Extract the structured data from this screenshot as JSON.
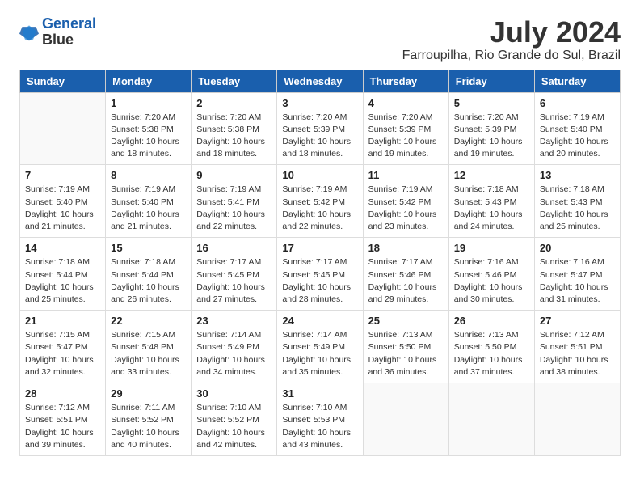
{
  "logo": {
    "line1": "General",
    "line2": "Blue"
  },
  "title": {
    "month": "July 2024",
    "location": "Farroupilha, Rio Grande do Sul, Brazil"
  },
  "columns": [
    "Sunday",
    "Monday",
    "Tuesday",
    "Wednesday",
    "Thursday",
    "Friday",
    "Saturday"
  ],
  "weeks": [
    [
      {
        "day": "",
        "info": ""
      },
      {
        "day": "1",
        "info": "Sunrise: 7:20 AM\nSunset: 5:38 PM\nDaylight: 10 hours\nand 18 minutes."
      },
      {
        "day": "2",
        "info": "Sunrise: 7:20 AM\nSunset: 5:38 PM\nDaylight: 10 hours\nand 18 minutes."
      },
      {
        "day": "3",
        "info": "Sunrise: 7:20 AM\nSunset: 5:39 PM\nDaylight: 10 hours\nand 18 minutes."
      },
      {
        "day": "4",
        "info": "Sunrise: 7:20 AM\nSunset: 5:39 PM\nDaylight: 10 hours\nand 19 minutes."
      },
      {
        "day": "5",
        "info": "Sunrise: 7:20 AM\nSunset: 5:39 PM\nDaylight: 10 hours\nand 19 minutes."
      },
      {
        "day": "6",
        "info": "Sunrise: 7:19 AM\nSunset: 5:40 PM\nDaylight: 10 hours\nand 20 minutes."
      }
    ],
    [
      {
        "day": "7",
        "info": "Sunrise: 7:19 AM\nSunset: 5:40 PM\nDaylight: 10 hours\nand 21 minutes."
      },
      {
        "day": "8",
        "info": "Sunrise: 7:19 AM\nSunset: 5:40 PM\nDaylight: 10 hours\nand 21 minutes."
      },
      {
        "day": "9",
        "info": "Sunrise: 7:19 AM\nSunset: 5:41 PM\nDaylight: 10 hours\nand 22 minutes."
      },
      {
        "day": "10",
        "info": "Sunrise: 7:19 AM\nSunset: 5:42 PM\nDaylight: 10 hours\nand 22 minutes."
      },
      {
        "day": "11",
        "info": "Sunrise: 7:19 AM\nSunset: 5:42 PM\nDaylight: 10 hours\nand 23 minutes."
      },
      {
        "day": "12",
        "info": "Sunrise: 7:18 AM\nSunset: 5:43 PM\nDaylight: 10 hours\nand 24 minutes."
      },
      {
        "day": "13",
        "info": "Sunrise: 7:18 AM\nSunset: 5:43 PM\nDaylight: 10 hours\nand 25 minutes."
      }
    ],
    [
      {
        "day": "14",
        "info": "Sunrise: 7:18 AM\nSunset: 5:44 PM\nDaylight: 10 hours\nand 25 minutes."
      },
      {
        "day": "15",
        "info": "Sunrise: 7:18 AM\nSunset: 5:44 PM\nDaylight: 10 hours\nand 26 minutes."
      },
      {
        "day": "16",
        "info": "Sunrise: 7:17 AM\nSunset: 5:45 PM\nDaylight: 10 hours\nand 27 minutes."
      },
      {
        "day": "17",
        "info": "Sunrise: 7:17 AM\nSunset: 5:45 PM\nDaylight: 10 hours\nand 28 minutes."
      },
      {
        "day": "18",
        "info": "Sunrise: 7:17 AM\nSunset: 5:46 PM\nDaylight: 10 hours\nand 29 minutes."
      },
      {
        "day": "19",
        "info": "Sunrise: 7:16 AM\nSunset: 5:46 PM\nDaylight: 10 hours\nand 30 minutes."
      },
      {
        "day": "20",
        "info": "Sunrise: 7:16 AM\nSunset: 5:47 PM\nDaylight: 10 hours\nand 31 minutes."
      }
    ],
    [
      {
        "day": "21",
        "info": "Sunrise: 7:15 AM\nSunset: 5:47 PM\nDaylight: 10 hours\nand 32 minutes."
      },
      {
        "day": "22",
        "info": "Sunrise: 7:15 AM\nSunset: 5:48 PM\nDaylight: 10 hours\nand 33 minutes."
      },
      {
        "day": "23",
        "info": "Sunrise: 7:14 AM\nSunset: 5:49 PM\nDaylight: 10 hours\nand 34 minutes."
      },
      {
        "day": "24",
        "info": "Sunrise: 7:14 AM\nSunset: 5:49 PM\nDaylight: 10 hours\nand 35 minutes."
      },
      {
        "day": "25",
        "info": "Sunrise: 7:13 AM\nSunset: 5:50 PM\nDaylight: 10 hours\nand 36 minutes."
      },
      {
        "day": "26",
        "info": "Sunrise: 7:13 AM\nSunset: 5:50 PM\nDaylight: 10 hours\nand 37 minutes."
      },
      {
        "day": "27",
        "info": "Sunrise: 7:12 AM\nSunset: 5:51 PM\nDaylight: 10 hours\nand 38 minutes."
      }
    ],
    [
      {
        "day": "28",
        "info": "Sunrise: 7:12 AM\nSunset: 5:51 PM\nDaylight: 10 hours\nand 39 minutes."
      },
      {
        "day": "29",
        "info": "Sunrise: 7:11 AM\nSunset: 5:52 PM\nDaylight: 10 hours\nand 40 minutes."
      },
      {
        "day": "30",
        "info": "Sunrise: 7:10 AM\nSunset: 5:52 PM\nDaylight: 10 hours\nand 42 minutes."
      },
      {
        "day": "31",
        "info": "Sunrise: 7:10 AM\nSunset: 5:53 PM\nDaylight: 10 hours\nand 43 minutes."
      },
      {
        "day": "",
        "info": ""
      },
      {
        "day": "",
        "info": ""
      },
      {
        "day": "",
        "info": ""
      }
    ]
  ]
}
